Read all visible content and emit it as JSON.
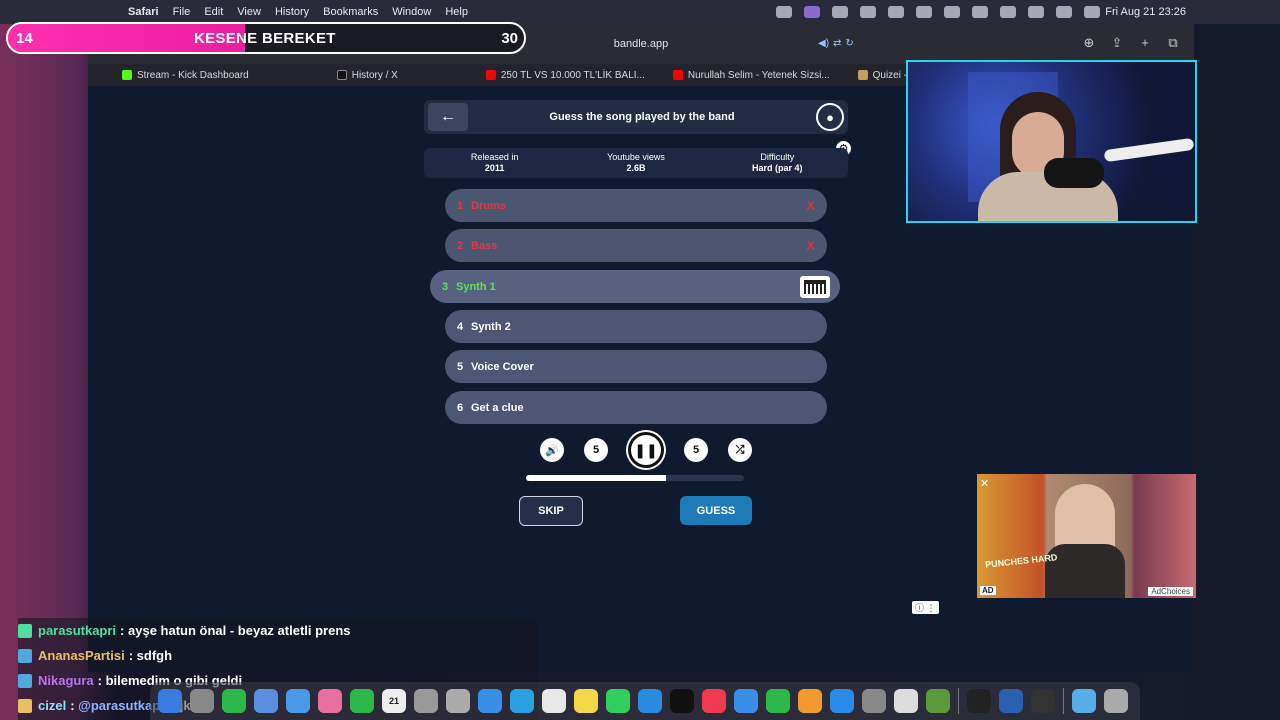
{
  "menubar": {
    "apple": "",
    "items": [
      "Safari",
      "File",
      "Edit",
      "View",
      "History",
      "Bookmarks",
      "Window",
      "Help"
    ],
    "clock": "Fri Aug 21  23:26"
  },
  "browser": {
    "address": "bandle.app",
    "tabs": [
      {
        "label": "Stream - Kick Dashboard",
        "color": "#53fc18"
      },
      {
        "label": "History / X",
        "color": "#111111"
      },
      {
        "label": "250 TL VS 10.000 TL'LİK BALI...",
        "color": "#ff0000"
      },
      {
        "label": "Nurullah Selim - Yetenek Sizsi...",
        "color": "#ff0000"
      },
      {
        "label": "Quizei - E",
        "color": "#c0a060"
      }
    ]
  },
  "overlay": {
    "left_count": "14",
    "title": "KESENE BEREKET",
    "right_count": "30",
    "progress": 0.46
  },
  "game": {
    "title": "Guess the song played by the band",
    "info": [
      {
        "label": "Released in",
        "value": "2011"
      },
      {
        "label": "Youtube views",
        "value": "2.6B"
      },
      {
        "label": "Difficulty",
        "value": "Hard (par 4)"
      }
    ],
    "tracks": [
      {
        "num": "1",
        "label": "Drums",
        "state": "wrong"
      },
      {
        "num": "2",
        "label": "Bass",
        "state": "wrong"
      },
      {
        "num": "3",
        "label": "Synth 1",
        "state": "active"
      },
      {
        "num": "4",
        "label": "Synth 2",
        "state": "locked"
      },
      {
        "num": "5",
        "label": "Voice Cover",
        "state": "locked"
      },
      {
        "num": "6",
        "label": "Get a clue",
        "state": "locked"
      }
    ],
    "wrong_mark": "X",
    "controls": {
      "volume": "🔊",
      "rewind": "5",
      "play": "❚❚",
      "forward": "5",
      "shuffle": "⤮"
    },
    "playback_progress": 0.64,
    "skip_label": "SKIP",
    "guess_label": "GUESS"
  },
  "ad": {
    "close": "✕",
    "label": "AD",
    "adchoices": "AdChoices",
    "title": "PUNCHES HARD"
  },
  "chat": [
    {
      "user": "parasutkapri",
      "user_color": "#4fe0a0",
      "badge_color": "#4fe0a0",
      "message": "ayşe hatun önal - beyaz atletli prens"
    },
    {
      "user": "AnanasPartisi",
      "user_color": "#e8c060",
      "badge_color": "#4fa8e0",
      "message": "sdfgh"
    },
    {
      "user": "Nikagura",
      "user_color": "#c070f0",
      "badge_color": "#4fa8e0",
      "message": "bilemedim o gibi geldi"
    },
    {
      "user": "cizel",
      "user_color": "#8fe0ff",
      "badge_color": "#e8c060",
      "mention": "@parasutkapri",
      "message": "ajkfl"
    }
  ],
  "dock": {
    "calendar_day": "21"
  }
}
